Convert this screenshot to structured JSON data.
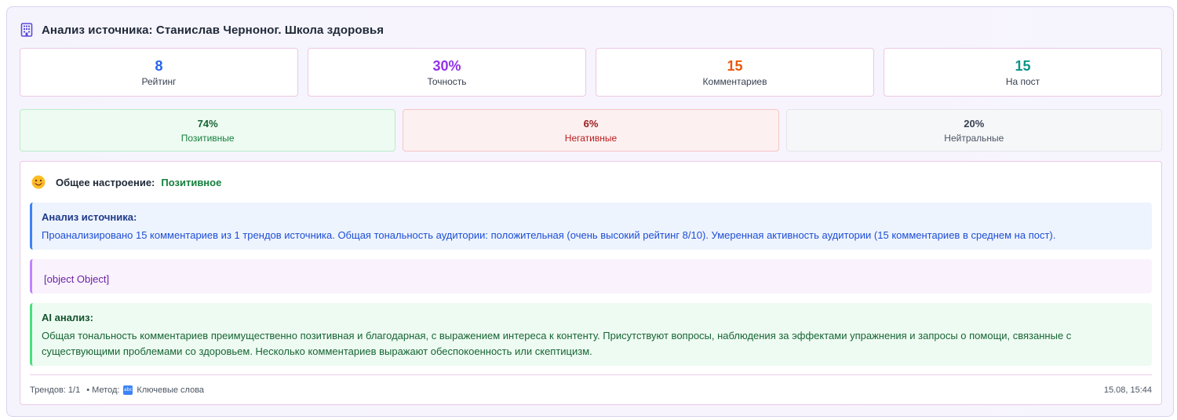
{
  "header": {
    "title": "Анализ источника: Станислав Черноног. Школа здоровья",
    "icon": "building-icon"
  },
  "stats": [
    {
      "value": "8",
      "label": "Рейтинг",
      "color": "#2563eb"
    },
    {
      "value": "30%",
      "label": "Точность",
      "color": "#9333ea"
    },
    {
      "value": "15",
      "label": "Комментариев",
      "color": "#ea580c"
    },
    {
      "value": "15",
      "label": "На пост",
      "color": "#0d9488"
    }
  ],
  "sentiment": {
    "positive": {
      "value": "74%",
      "label": "Позитивные"
    },
    "negative": {
      "value": "6%",
      "label": "Негативные"
    },
    "neutral": {
      "value": "20%",
      "label": "Нейтральные"
    }
  },
  "mood": {
    "emoji": "smiling-face-icon",
    "label": "Общее настроение:",
    "value": "Позитивное"
  },
  "source_analysis": {
    "title": "Анализ источника:",
    "text": "Проанализировано 15 комментариев из 1 трендов источника. Общая тональность аудитории: положительная (очень высокий рейтинг 8/10). Умеренная активность аудитории (15 комментариев в среднем на пост)."
  },
  "object_block": {
    "text": "[object Object]"
  },
  "ai_analysis": {
    "title": "AI анализ:",
    "text": "Общая тональность комментариев преимущественно позитивная и благодарная, с выражением интереса к контенту. Присутствуют вопросы, наблюдения за эффектами упражнения и запросы о помощи, связанные с существующими проблемами со здоровьем. Несколько комментариев выражают обеспокоенность или скептицизм."
  },
  "footer": {
    "trends": "Трендов: 1/1",
    "method_label": "• Метод:",
    "method_icon": "abc-icon",
    "method_icon_text": "abc",
    "method_value": "Ключевые слова",
    "timestamp": "15.08, 15:44"
  }
}
